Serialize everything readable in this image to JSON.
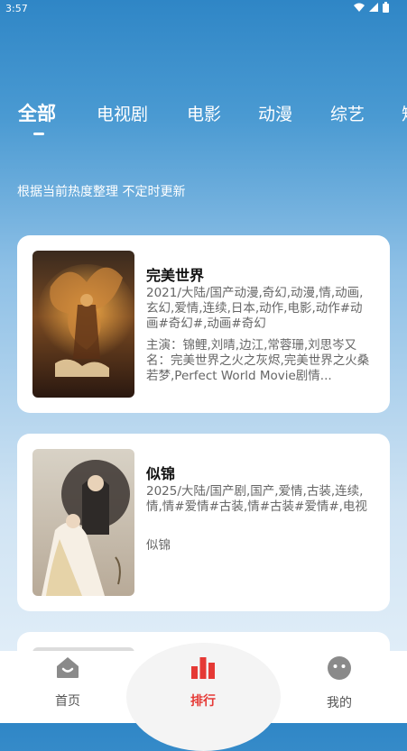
{
  "status_bar": {
    "time": "3:57"
  },
  "tabs": [
    "全部",
    "电视剧",
    "电影",
    "动漫",
    "综艺",
    "短"
  ],
  "subtitle": "根据当前热度整理 不定时更新",
  "items": [
    {
      "title": "完美世界",
      "meta": "2021/大陆/国产动漫,奇幻,动漫,情,动画,玄幻,爱情,连续,日本,动作,电影,动作#动画#奇幻#,动画#奇幻",
      "desc": "主演：锦鲤,刘晴,边江,常蓉珊,刘思岑又名：完美世界之火之灰烬,完美世界之火桑若梦,Perfect World Movie剧情..."
    },
    {
      "title": "似锦",
      "meta": "2025/大陆/国产剧,国产,爱情,古装,连续,情,情#爱情#古装,情#古装#爱情#,电视",
      "desc": "似锦"
    }
  ],
  "nav": [
    {
      "label": "首页",
      "icon": "home-face-icon",
      "active": false
    },
    {
      "label": "排行",
      "icon": "bar-chart-icon",
      "active": true
    },
    {
      "label": "我的",
      "icon": "smiley-face-icon",
      "active": false
    }
  ],
  "colors": {
    "accent": "#e53935",
    "header_blue": "#2f86c6"
  }
}
